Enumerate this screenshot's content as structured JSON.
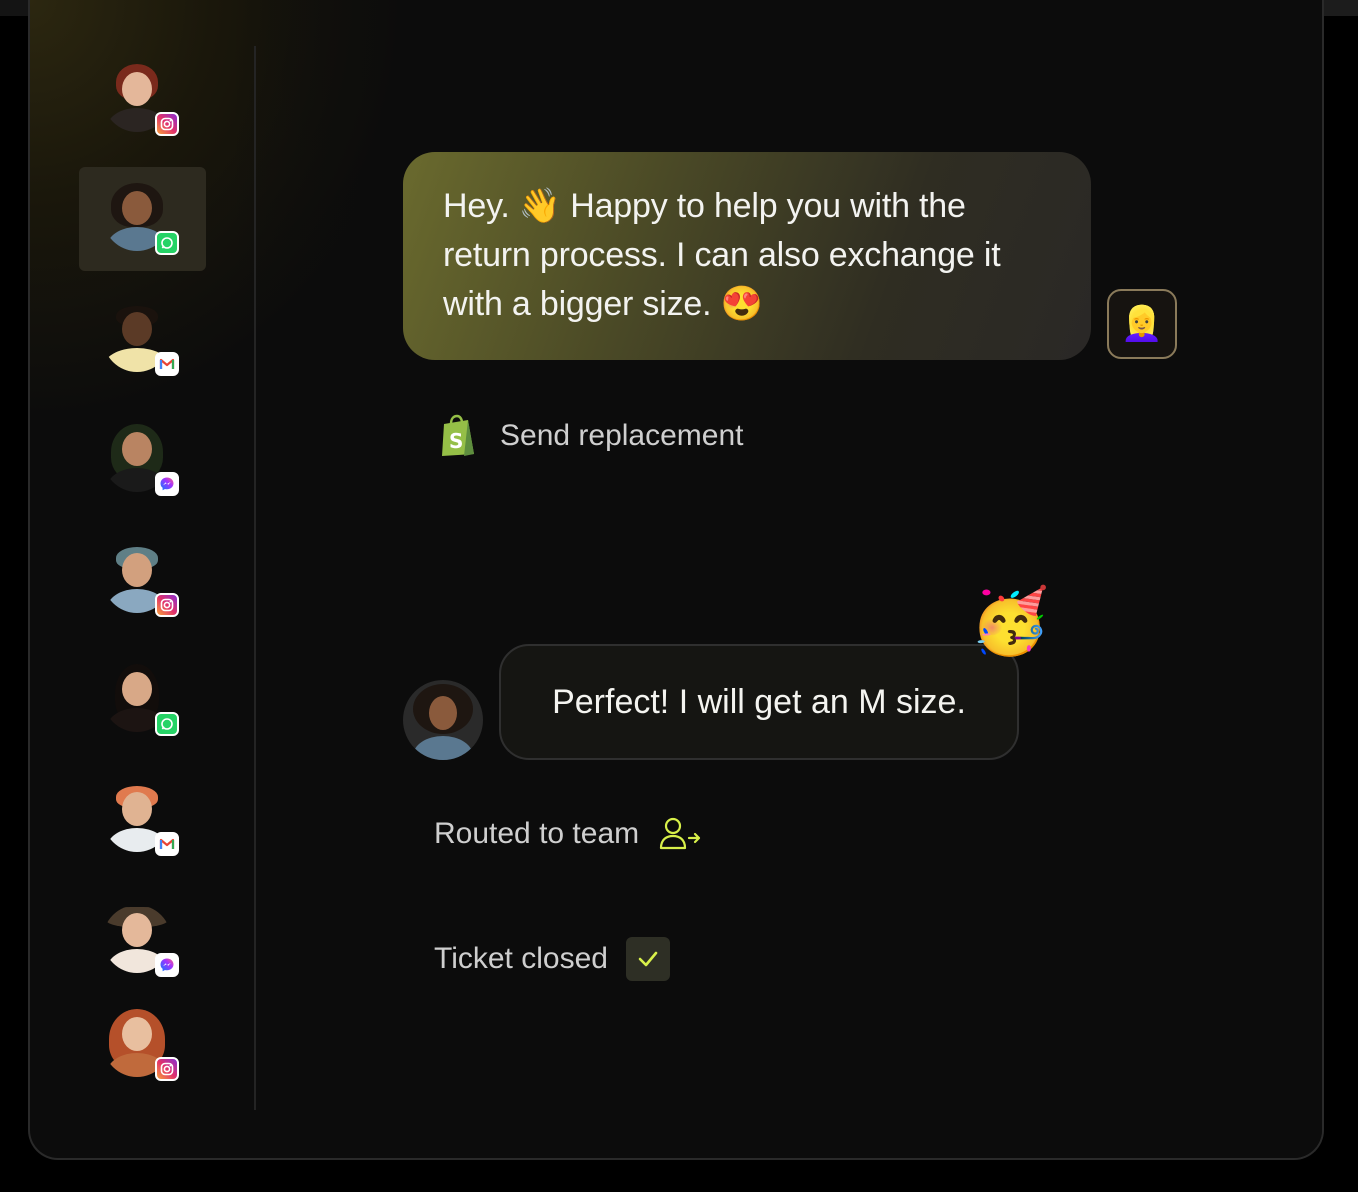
{
  "sidebar": {
    "conversations": [
      {
        "name": "conversation-1",
        "channel": "instagram",
        "active": false
      },
      {
        "name": "conversation-2",
        "channel": "whatsapp",
        "active": true
      },
      {
        "name": "conversation-3",
        "channel": "gmail",
        "active": false
      },
      {
        "name": "conversation-4",
        "channel": "messenger",
        "active": false
      },
      {
        "name": "conversation-5",
        "channel": "instagram",
        "active": false
      },
      {
        "name": "conversation-6",
        "channel": "whatsapp",
        "active": false
      },
      {
        "name": "conversation-7",
        "channel": "gmail",
        "active": false
      },
      {
        "name": "conversation-8",
        "channel": "messenger",
        "active": false
      },
      {
        "name": "conversation-9",
        "channel": "instagram",
        "active": false
      }
    ]
  },
  "chat": {
    "agent_message": {
      "line1": "Hey. 👋 Happy to help you with the",
      "line2": "return process. I can also exchange it",
      "line3": "with a bigger size. 😍",
      "avatar_emoji": "👱‍♀️"
    },
    "action_send_replacement": "Send replacement",
    "customer_message": "Perfect! I will get an M size.",
    "reaction_emoji": "🥳",
    "status_routed": "Routed to team",
    "status_closed": "Ticket closed"
  },
  "colors": {
    "accent": "#d8f04a",
    "shopify_green": "#95bf47",
    "active_item_bg": "#2d2a1f"
  }
}
